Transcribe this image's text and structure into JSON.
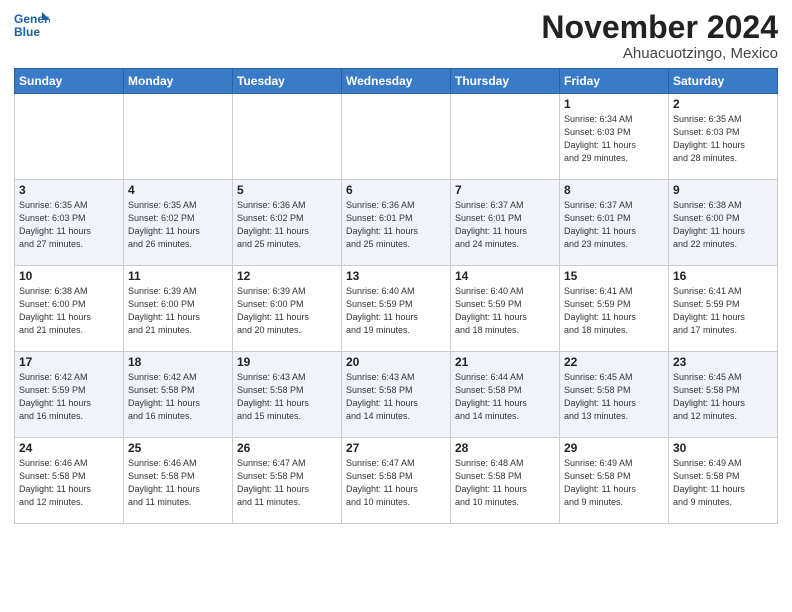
{
  "header": {
    "logo_line1": "General",
    "logo_line2": "Blue",
    "month": "November 2024",
    "location": "Ahuacuotzingo, Mexico"
  },
  "weekdays": [
    "Sunday",
    "Monday",
    "Tuesday",
    "Wednesday",
    "Thursday",
    "Friday",
    "Saturday"
  ],
  "weeks": [
    [
      {
        "day": "",
        "info": ""
      },
      {
        "day": "",
        "info": ""
      },
      {
        "day": "",
        "info": ""
      },
      {
        "day": "",
        "info": ""
      },
      {
        "day": "",
        "info": ""
      },
      {
        "day": "1",
        "info": "Sunrise: 6:34 AM\nSunset: 6:03 PM\nDaylight: 11 hours\nand 29 minutes."
      },
      {
        "day": "2",
        "info": "Sunrise: 6:35 AM\nSunset: 6:03 PM\nDaylight: 11 hours\nand 28 minutes."
      }
    ],
    [
      {
        "day": "3",
        "info": "Sunrise: 6:35 AM\nSunset: 6:03 PM\nDaylight: 11 hours\nand 27 minutes."
      },
      {
        "day": "4",
        "info": "Sunrise: 6:35 AM\nSunset: 6:02 PM\nDaylight: 11 hours\nand 26 minutes."
      },
      {
        "day": "5",
        "info": "Sunrise: 6:36 AM\nSunset: 6:02 PM\nDaylight: 11 hours\nand 25 minutes."
      },
      {
        "day": "6",
        "info": "Sunrise: 6:36 AM\nSunset: 6:01 PM\nDaylight: 11 hours\nand 25 minutes."
      },
      {
        "day": "7",
        "info": "Sunrise: 6:37 AM\nSunset: 6:01 PM\nDaylight: 11 hours\nand 24 minutes."
      },
      {
        "day": "8",
        "info": "Sunrise: 6:37 AM\nSunset: 6:01 PM\nDaylight: 11 hours\nand 23 minutes."
      },
      {
        "day": "9",
        "info": "Sunrise: 6:38 AM\nSunset: 6:00 PM\nDaylight: 11 hours\nand 22 minutes."
      }
    ],
    [
      {
        "day": "10",
        "info": "Sunrise: 6:38 AM\nSunset: 6:00 PM\nDaylight: 11 hours\nand 21 minutes."
      },
      {
        "day": "11",
        "info": "Sunrise: 6:39 AM\nSunset: 6:00 PM\nDaylight: 11 hours\nand 21 minutes."
      },
      {
        "day": "12",
        "info": "Sunrise: 6:39 AM\nSunset: 6:00 PM\nDaylight: 11 hours\nand 20 minutes."
      },
      {
        "day": "13",
        "info": "Sunrise: 6:40 AM\nSunset: 5:59 PM\nDaylight: 11 hours\nand 19 minutes."
      },
      {
        "day": "14",
        "info": "Sunrise: 6:40 AM\nSunset: 5:59 PM\nDaylight: 11 hours\nand 18 minutes."
      },
      {
        "day": "15",
        "info": "Sunrise: 6:41 AM\nSunset: 5:59 PM\nDaylight: 11 hours\nand 18 minutes."
      },
      {
        "day": "16",
        "info": "Sunrise: 6:41 AM\nSunset: 5:59 PM\nDaylight: 11 hours\nand 17 minutes."
      }
    ],
    [
      {
        "day": "17",
        "info": "Sunrise: 6:42 AM\nSunset: 5:59 PM\nDaylight: 11 hours\nand 16 minutes."
      },
      {
        "day": "18",
        "info": "Sunrise: 6:42 AM\nSunset: 5:58 PM\nDaylight: 11 hours\nand 16 minutes."
      },
      {
        "day": "19",
        "info": "Sunrise: 6:43 AM\nSunset: 5:58 PM\nDaylight: 11 hours\nand 15 minutes."
      },
      {
        "day": "20",
        "info": "Sunrise: 6:43 AM\nSunset: 5:58 PM\nDaylight: 11 hours\nand 14 minutes."
      },
      {
        "day": "21",
        "info": "Sunrise: 6:44 AM\nSunset: 5:58 PM\nDaylight: 11 hours\nand 14 minutes."
      },
      {
        "day": "22",
        "info": "Sunrise: 6:45 AM\nSunset: 5:58 PM\nDaylight: 11 hours\nand 13 minutes."
      },
      {
        "day": "23",
        "info": "Sunrise: 6:45 AM\nSunset: 5:58 PM\nDaylight: 11 hours\nand 12 minutes."
      }
    ],
    [
      {
        "day": "24",
        "info": "Sunrise: 6:46 AM\nSunset: 5:58 PM\nDaylight: 11 hours\nand 12 minutes."
      },
      {
        "day": "25",
        "info": "Sunrise: 6:46 AM\nSunset: 5:58 PM\nDaylight: 11 hours\nand 11 minutes."
      },
      {
        "day": "26",
        "info": "Sunrise: 6:47 AM\nSunset: 5:58 PM\nDaylight: 11 hours\nand 11 minutes."
      },
      {
        "day": "27",
        "info": "Sunrise: 6:47 AM\nSunset: 5:58 PM\nDaylight: 11 hours\nand 10 minutes."
      },
      {
        "day": "28",
        "info": "Sunrise: 6:48 AM\nSunset: 5:58 PM\nDaylight: 11 hours\nand 10 minutes."
      },
      {
        "day": "29",
        "info": "Sunrise: 6:49 AM\nSunset: 5:58 PM\nDaylight: 11 hours\nand 9 minutes."
      },
      {
        "day": "30",
        "info": "Sunrise: 6:49 AM\nSunset: 5:58 PM\nDaylight: 11 hours\nand 9 minutes."
      }
    ]
  ]
}
